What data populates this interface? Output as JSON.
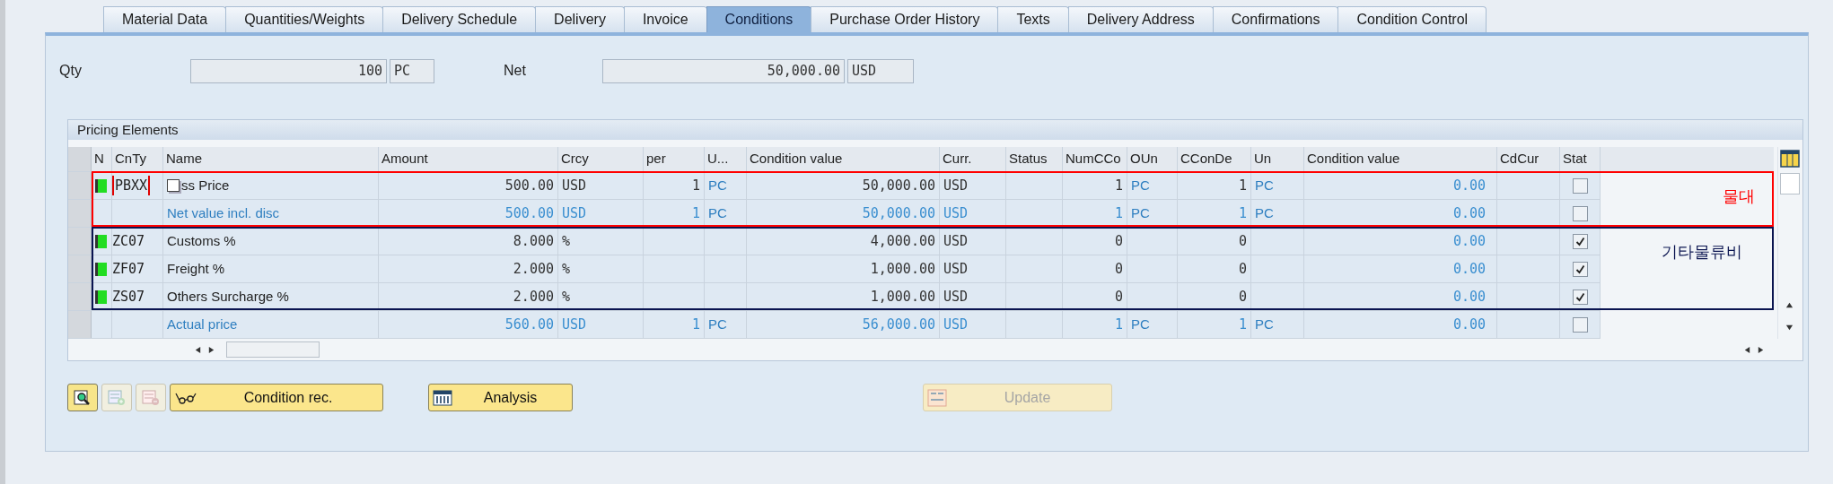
{
  "tabs": [
    {
      "label": "Material Data",
      "selected": false
    },
    {
      "label": "Quantities/Weights",
      "selected": false
    },
    {
      "label": "Delivery Schedule",
      "selected": false
    },
    {
      "label": "Delivery",
      "selected": false
    },
    {
      "label": "Invoice",
      "selected": false
    },
    {
      "label": "Conditions",
      "selected": true
    },
    {
      "label": "Purchase Order History",
      "selected": false
    },
    {
      "label": "Texts",
      "selected": false
    },
    {
      "label": "Delivery Address",
      "selected": false
    },
    {
      "label": "Confirmations",
      "selected": false
    },
    {
      "label": "Condition Control",
      "selected": false
    }
  ],
  "header_fields": [
    {
      "label": "Qty",
      "value": "100",
      "unit": "PC"
    },
    {
      "label": "Net",
      "value": "50,000.00",
      "unit": "USD"
    }
  ],
  "pricing": {
    "title": "Pricing Elements",
    "columns": [
      "N",
      "CnTy",
      "Name",
      "Amount",
      "Crcy",
      "per",
      "U...",
      "Condition value",
      "Curr.",
      "Status",
      "NumCCo",
      "OUn",
      "CConDe",
      "Un",
      "Condition value",
      "CdCur",
      "Stat"
    ],
    "groups": [
      {
        "note": "물대",
        "color": "#ff0000",
        "rows": [
          {
            "kind": "condition",
            "active": true,
            "bracketed": true,
            "copy_icon": true,
            "code": "PBXX",
            "name": "ss Price",
            "amount": "500.00",
            "crcy": "USD",
            "per": "1",
            "unit": "PC",
            "value": "50,000.00",
            "curr": "USD",
            "numcco": "1",
            "oun": "PC",
            "cconde": "1",
            "un": "PC",
            "value2": "0.00",
            "checked": false
          },
          {
            "kind": "subtotal",
            "active": false,
            "bracketed": false,
            "copy_icon": false,
            "name": "Net value incl. disc",
            "amount": "500.00",
            "crcy": "USD",
            "per": "1",
            "unit": "PC",
            "value": "50,000.00",
            "curr": "USD",
            "numcco": "1",
            "oun": "PC",
            "cconde": "1",
            "un": "PC",
            "value2": "0.00",
            "checked": false
          }
        ]
      },
      {
        "note": "기타물류비",
        "color": "#0a1450",
        "rows": [
          {
            "kind": "condition",
            "active": true,
            "bracketed": false,
            "copy_icon": false,
            "code": "ZC07",
            "name": "Customs %",
            "amount": "8.000",
            "crcy": "%",
            "value": "4,000.00",
            "curr": "USD",
            "numcco": "0",
            "cconde": "0",
            "value2": "0.00",
            "checked": true
          },
          {
            "kind": "condition",
            "active": true,
            "bracketed": false,
            "copy_icon": false,
            "code": "ZF07",
            "name": "Freight %",
            "amount": "2.000",
            "crcy": "%",
            "value": "1,000.00",
            "curr": "USD",
            "numcco": "0",
            "cconde": "0",
            "value2": "0.00",
            "checked": true
          },
          {
            "kind": "condition",
            "active": true,
            "bracketed": false,
            "copy_icon": false,
            "code": "ZS07",
            "name": "Others Surcharge %",
            "amount": "2.000",
            "crcy": "%",
            "value": "1,000.00",
            "curr": "USD",
            "numcco": "0",
            "cconde": "0",
            "value2": "0.00",
            "checked": true
          }
        ]
      },
      {
        "rows": [
          {
            "kind": "subtotal",
            "active": false,
            "bracketed": false,
            "copy_icon": false,
            "name": "Actual price",
            "amount": "560.00",
            "crcy": "USD",
            "per": "1",
            "unit": "PC",
            "value": "56,000.00",
            "curr": "USD",
            "numcco": "1",
            "oun": "PC",
            "cconde": "1",
            "un": "PC",
            "value2": "0.00",
            "checked": false
          }
        ]
      }
    ]
  },
  "buttons": [
    {
      "kind": "icon",
      "disabled": false
    },
    {
      "kind": "icon",
      "disabled": true
    },
    {
      "kind": "icon",
      "disabled": true
    },
    {
      "kind": "text",
      "label": "Condition rec.",
      "disabled": false
    },
    {
      "kind": "text",
      "label": "Analysis",
      "disabled": false
    },
    {
      "kind": "text",
      "label": "Update",
      "disabled": true
    }
  ]
}
